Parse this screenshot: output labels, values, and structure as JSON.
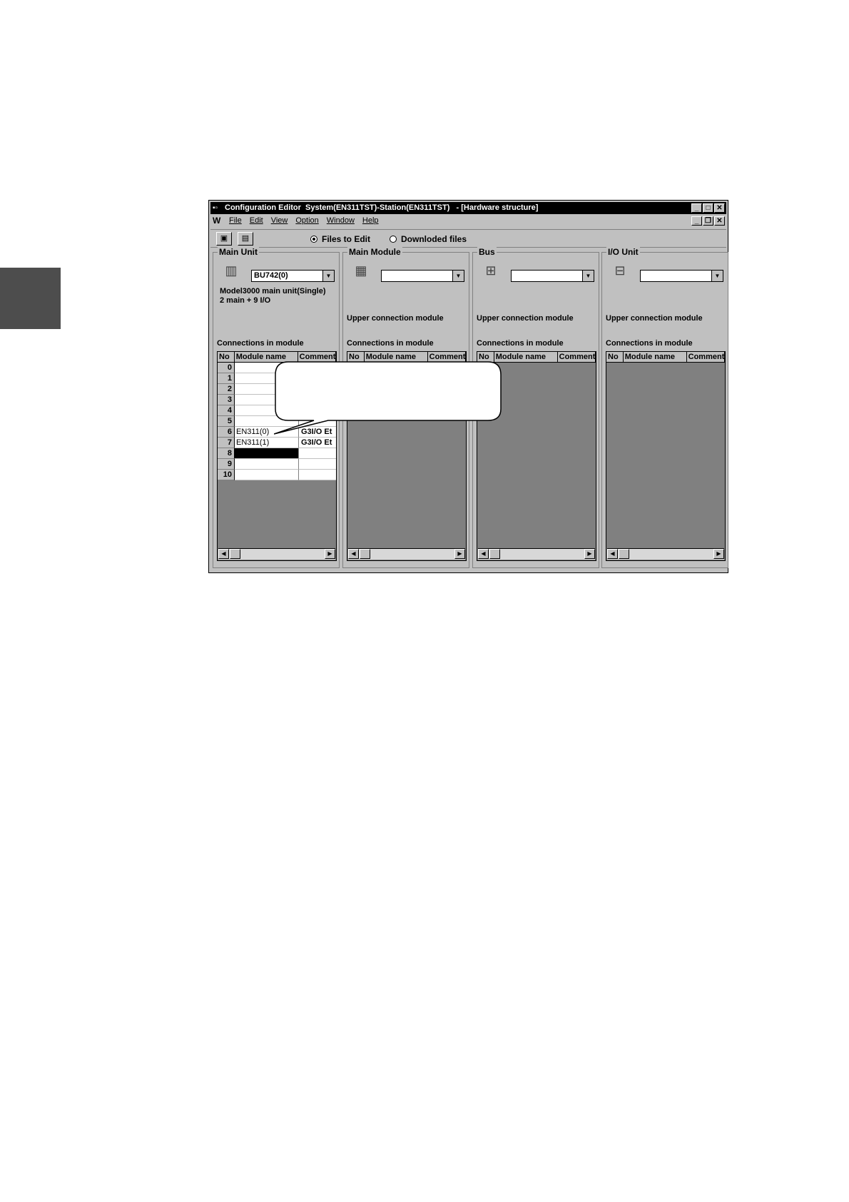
{
  "window": {
    "title": "Configuration Editor  System(EN311TST)-Station(EN311TST)   - [Hardware structure]",
    "minimize": "_",
    "maximize": "□",
    "close": "✕",
    "restore": "❐"
  },
  "menu": [
    "File",
    "Edit",
    "View",
    "Option",
    "Window",
    "Help"
  ],
  "toolbar": {
    "save_icon": "floppy-disk-icon",
    "properties_icon": "properties-icon",
    "radio_files_to_edit": "Files to Edit",
    "radio_downloaded_files": "Downloded files",
    "selected": "Files to Edit"
  },
  "panels": [
    {
      "title": "Main Unit",
      "combo_value": "BU742(0)",
      "desc_line1": "Model3000 main unit(Single)",
      "desc_line2": "2 main + 9 I/O",
      "upper": "",
      "connections_label": "Connections in module",
      "headers": [
        "No",
        "Module name",
        "Comment"
      ],
      "rows": [
        {
          "no": "0",
          "name": "",
          "comment": ""
        },
        {
          "no": "1",
          "name": "",
          "comment": ""
        },
        {
          "no": "2",
          "name": "",
          "comment": ""
        },
        {
          "no": "3",
          "name": "",
          "comment": ""
        },
        {
          "no": "4",
          "name": "",
          "comment": ""
        },
        {
          "no": "5",
          "name": "",
          "comment": ""
        },
        {
          "no": "6",
          "name": "EN311(0)",
          "comment": "G3I/O Et"
        },
        {
          "no": "7",
          "name": "EN311(1)",
          "comment": "G3I/O Et"
        },
        {
          "no": "8",
          "name": "",
          "comment": ""
        },
        {
          "no": "9",
          "name": "",
          "comment": ""
        },
        {
          "no": "10",
          "name": "",
          "comment": ""
        }
      ]
    },
    {
      "title": "Main Module",
      "combo_value": "",
      "upper": "Upper connection module",
      "connections_label": "Connections in module",
      "headers": [
        "No",
        "Module name",
        "Comment"
      ]
    },
    {
      "title": "Bus",
      "combo_value": "",
      "upper": "Upper connection module",
      "connections_label": "Connections in module",
      "headers": [
        "No",
        "Module name",
        "Comment"
      ]
    },
    {
      "title": "I/O Unit",
      "combo_value": "",
      "upper": "Upper connection module",
      "connections_label": "Connections in module",
      "headers": [
        "No",
        "Module name",
        "Comment"
      ]
    }
  ]
}
